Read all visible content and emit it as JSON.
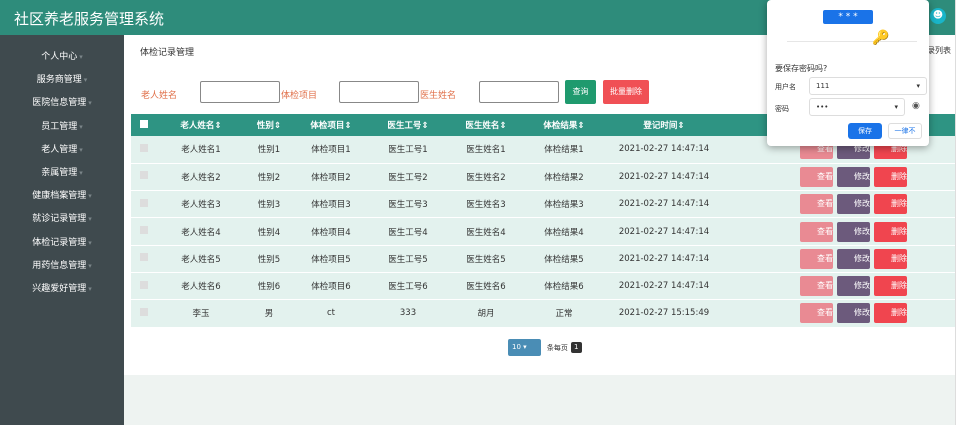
{
  "header": {
    "title": "社区养老服务管理系统",
    "avatar_icon": "user-icon"
  },
  "sidebar": {
    "items": [
      {
        "label": "个人中心"
      },
      {
        "label": "服务商管理"
      },
      {
        "label": "医院信息管理"
      },
      {
        "label": "员工管理"
      },
      {
        "label": "老人管理"
      },
      {
        "label": "亲属管理"
      },
      {
        "label": "健康档案管理"
      },
      {
        "label": "就诊记录管理"
      },
      {
        "label": "体检记录管理"
      },
      {
        "label": "用药信息管理"
      },
      {
        "label": "兴趣爱好管理"
      }
    ]
  },
  "main": {
    "title": "体检记录管理",
    "breadcrumb": "录列表",
    "search": {
      "elder_label": "老人姓名",
      "item_label": "体检项目",
      "doctor_label": "医生姓名",
      "search_button": "查询",
      "batch_delete_button": "批量删除"
    },
    "table": {
      "headers": [
        "老人姓名",
        "性别",
        "体检项目",
        "医生工号",
        "医生姓名",
        "体检结果",
        "登记时间"
      ],
      "rows": [
        [
          "老人姓名1",
          "性别1",
          "体检项目1",
          "医生工号1",
          "医生姓名1",
          "体检结果1",
          "2021-02-27 14:47:14"
        ],
        [
          "老人姓名2",
          "性别2",
          "体检项目2",
          "医生工号2",
          "医生姓名2",
          "体检结果2",
          "2021-02-27 14:47:14"
        ],
        [
          "老人姓名3",
          "性别3",
          "体检项目3",
          "医生工号3",
          "医生姓名3",
          "体检结果3",
          "2021-02-27 14:47:14"
        ],
        [
          "老人姓名4",
          "性别4",
          "体检项目4",
          "医生工号4",
          "医生姓名4",
          "体检结果4",
          "2021-02-27 14:47:14"
        ],
        [
          "老人姓名5",
          "性别5",
          "体检项目5",
          "医生工号5",
          "医生姓名5",
          "体检结果5",
          "2021-02-27 14:47:14"
        ],
        [
          "老人姓名6",
          "性别6",
          "体检项目6",
          "医生工号6",
          "医生姓名6",
          "体检结果6",
          "2021-02-27 14:47:14"
        ],
        [
          "李玉",
          "男",
          "ct",
          "333",
          "胡月",
          "正常",
          "2021-02-27 15:15:49"
        ]
      ],
      "actions": {
        "view": "查看",
        "edit": "修改",
        "delete": "删除"
      }
    },
    "pagination": {
      "page_size": "10",
      "per_page_label": "条每页",
      "current_page": "1"
    }
  },
  "popup": {
    "question": "要保存密码吗?",
    "username_label": "用户名",
    "username_value": "111",
    "password_label": "密码",
    "password_value": "•••",
    "save_button": "保存",
    "never_button": "一律不"
  },
  "colors": {
    "header": "#2e8c7b",
    "sidebar": "#3f4a4e",
    "view": "#e98a93",
    "edit": "#6c5a7c",
    "delete": "#f0454f",
    "search": "#1f9a6e"
  }
}
